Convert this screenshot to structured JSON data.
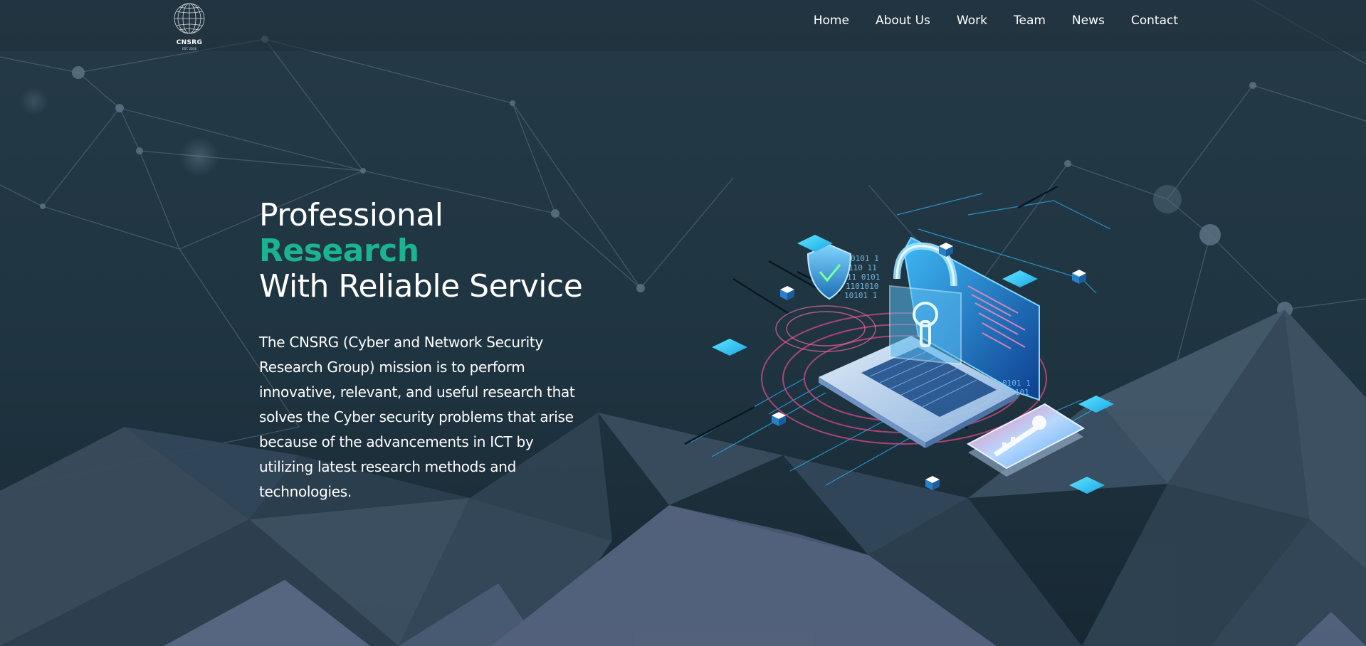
{
  "logo": {
    "text": "CNSRG",
    "subtext": "EST. 2018"
  },
  "nav": {
    "items": [
      {
        "label": "Home"
      },
      {
        "label": "About Us"
      },
      {
        "label": "Work"
      },
      {
        "label": "Team"
      },
      {
        "label": "News"
      },
      {
        "label": "Contact"
      }
    ]
  },
  "hero": {
    "title_line1": "Professional",
    "title_line2": "Research",
    "title_line3": "With Reliable Service",
    "description": "The CNSRG (Cyber and Network Security Research Group) mission is to perform innovative, relevant, and useful research that solves the Cyber security problems that arise because of the advancements in ICT by utilizing latest research methods and technologies."
  },
  "colors": {
    "accent": "#1bb493",
    "background": "#1f3340",
    "text": "#ffffff"
  }
}
